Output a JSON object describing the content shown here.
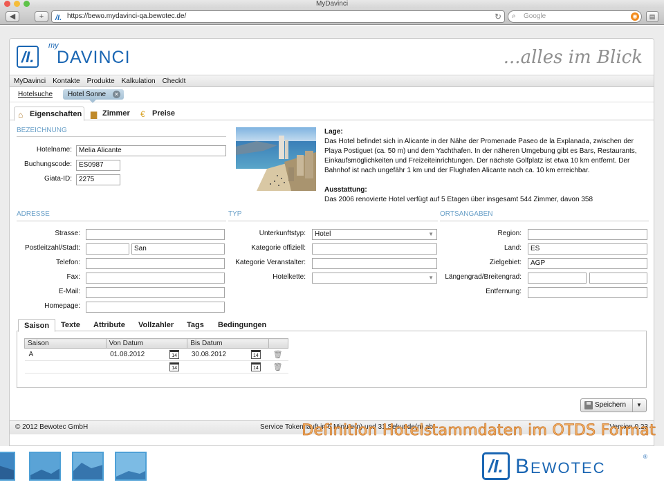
{
  "browser": {
    "window_title": "MyDavinci",
    "back_label": "◀",
    "add_label": "+",
    "url": "https://bewo.mydavinci-qa.bewotec.de/",
    "search_placeholder": "Google"
  },
  "header": {
    "logo_my": "my",
    "logo_text": "DAVINCI",
    "slogan": "...alles im Blick"
  },
  "menu": [
    "MyDavinci",
    "Kontakte",
    "Produkte",
    "Kalkulation",
    "CheckIt"
  ],
  "breadcrumb": {
    "link": "Hotelsuche",
    "active_tab": "Hotel Sonne"
  },
  "main_tabs": [
    {
      "label": "Eigenschaften",
      "icon": "house-icon"
    },
    {
      "label": "Zimmer",
      "icon": "bed-icon"
    },
    {
      "label": "Preise",
      "icon": "euro-icon"
    }
  ],
  "bezeichnung": {
    "section_title": "BEZEICHNUNG",
    "hotelname_label": "Hotelname:",
    "hotelname_value": "Melia Alicante",
    "buchungscode_label": "Buchungscode:",
    "buchungscode_value": "ES0987",
    "giata_label": "Giata-ID:",
    "giata_value": "2275"
  },
  "description": {
    "lage_title": "Lage:",
    "lage_text": "Das Hotel befindet sich in Alicante in der Nähe der Promenade Paseo de la Explanada, zwischen der Playa Postiguet (ca. 50 m) und dem Yachthafen. In der näheren Umgebung gibt es Bars, Restaurants, Einkaufsmöglichkeiten und Freizeiteinrichtungen. Der nächste Golfplatz ist etwa 10 km entfernt. Der Bahnhof ist nach ungefähr 1 km und der Flughafen Alicante nach ca. 10 km erreichbar.",
    "ausstattung_title": "Ausstattung:",
    "ausstattung_text": "Das 2006 renovierte Hotel verfügt auf 5 Etagen über insgesamt 544 Zimmer, davon 358"
  },
  "adresse": {
    "section_title": "ADRESSE",
    "strasse_label": "Strasse:",
    "strasse_value": "",
    "plz_label": "Postleitzahl/Stadt:",
    "plz_value": "",
    "stadt_value": "San",
    "telefon_label": "Telefon:",
    "fax_label": "Fax:",
    "email_label": "E-Mail:",
    "homepage_label": "Homepage:"
  },
  "typ": {
    "section_title": "TYP",
    "unterkunftstyp_label": "Unterkunftstyp:",
    "unterkunftstyp_value": "Hotel",
    "kategorie_offiziell_label": "Kategorie offiziell:",
    "kategorie_veranstalter_label": "Kategorie Veranstalter:",
    "hotelkette_label": "Hotelkette:"
  },
  "ortsangaben": {
    "section_title": "ORTSANGABEN",
    "region_label": "Region:",
    "land_label": "Land:",
    "land_value": "ES",
    "zielgebiet_label": "Zielgebiet:",
    "zielgebiet_value": "AGP",
    "laengengrad_label": "Längengrad/Breitengrad:",
    "entfernung_label": "Entfernung:"
  },
  "sub_tabs": [
    "Saison",
    "Texte",
    "Attribute",
    "Vollzahler",
    "Tags",
    "Bedingungen"
  ],
  "season_table": {
    "headers": [
      "Saison",
      "Von Datum",
      "Bis Datum"
    ],
    "rows": [
      {
        "saison": "A",
        "von": "01.08.2012",
        "bis": "30.08.2012"
      },
      {
        "saison": "",
        "von": "",
        "bis": ""
      }
    ],
    "calendar_day": "14"
  },
  "save_button": "Speichern",
  "footer": {
    "copyright": "© 2012 Bewotec GmbH",
    "token": "Service Token läuft in 6 Minute(n) und 31 Sekunde(n) ab.",
    "version": "Version 0.23"
  },
  "caption": "Definition Hotelstammdaten im OTDS Format",
  "brand": {
    "name_first": "B",
    "name_rest": "EWOTEC",
    "registered": "®"
  },
  "colors": {
    "accent_blue": "#1a66b3",
    "section_title": "#6aa0c8",
    "caption_orange": "#f2b36a"
  }
}
